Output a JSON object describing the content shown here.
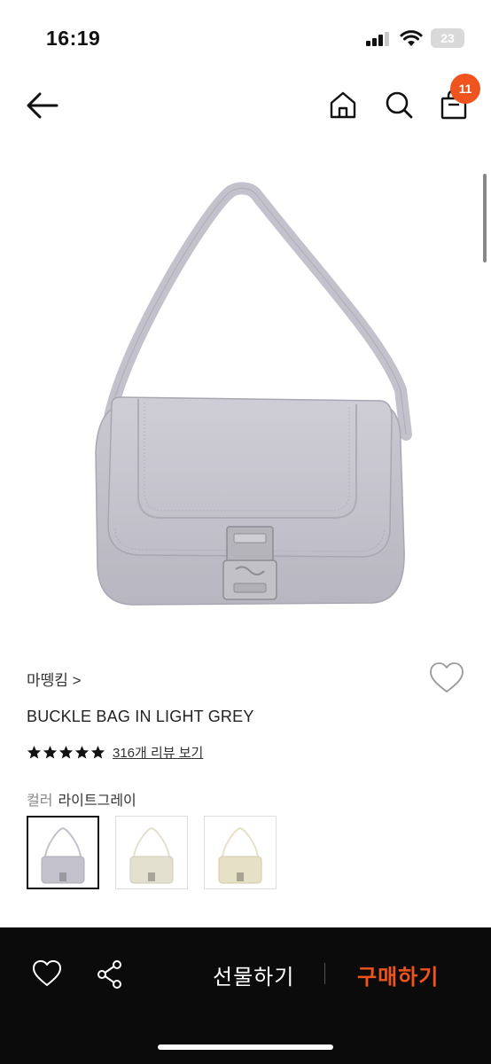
{
  "status": {
    "time": "16:19",
    "battery": "23"
  },
  "nav": {
    "cart_count": "11"
  },
  "product": {
    "brand": "마뗑킴 >",
    "name": "BUCKLE BAG IN LIGHT GREY",
    "rating_stars": 5,
    "review_link": "316개 리뷰 보기",
    "color_label": "컬러",
    "color_value": "라이트그레이"
  },
  "swatches": [
    {
      "color": "#c3c1cb",
      "selected": true
    },
    {
      "color": "#e4e0d0",
      "selected": false
    },
    {
      "color": "#e6e0c6",
      "selected": false
    }
  ],
  "bottom": {
    "gift_label": "선물하기",
    "buy_label": "구매하기"
  },
  "colors": {
    "accent": "#f0541e",
    "bag": "#c3c1cb"
  }
}
